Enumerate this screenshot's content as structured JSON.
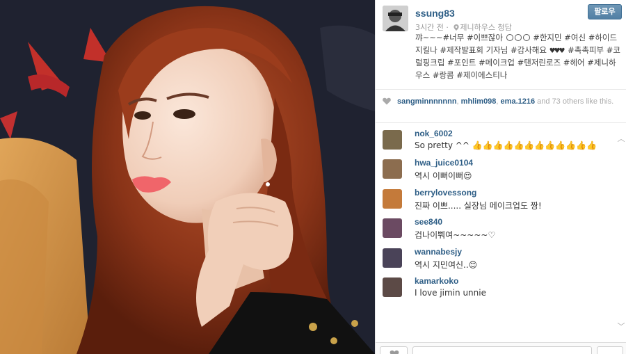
{
  "post": {
    "image_alt": "",
    "owner": {
      "username": "ssung83",
      "time_ago": "3시간 전",
      "separator": "·",
      "location": "제니하우스 청담"
    },
    "follow_label": "팔로우",
    "caption": {
      "part1": "꺄~~~#너무 #이쁘잖아 ",
      "part2": " #한지민 #여신 #하이드지킬나 #제작발표회 기자님 #감사해요 ",
      "part3": " #촉촉피부 #코럴핑크립 #포인트 #메이크업 #탠저린로즈 #헤어 #제니하우스 #랑콤 #제이에스티나"
    },
    "likes": {
      "users": [
        "sangminnnnnnn",
        "mhlim098",
        "ema.1216"
      ],
      "sep": ", ",
      "and": " and ",
      "others": "73 others like this."
    },
    "comments": [
      {
        "user": "nok_6002",
        "text": "So pretty ^^ 👍👍👍👍👍👍👍👍👍👍👍👍",
        "avatar_color": "#7a6a4c"
      },
      {
        "user": "hwa_juice0104",
        "text": "역시 이뻐이뻐😍",
        "avatar_color": "#8c6d4f"
      },
      {
        "user": "berrylovessong",
        "text": "진짜 이쁘..... 실장님 메이크업도 짱!",
        "avatar_color": "#c47a3a"
      },
      {
        "user": "see840",
        "text": "겁나이뿨여~~~~~♡",
        "avatar_color": "#6b4a62"
      },
      {
        "user": "wannabesjy",
        "text": "역시 지민여신..😊",
        "avatar_color": "#4a4358"
      },
      {
        "user": "kamarkoko",
        "text": "I love jimin unnie",
        "avatar_color": "#5c4a46"
      }
    ],
    "comment_placeholder": "",
    "colors": {
      "link": "#2e5e86",
      "follow_button": "#517fa4",
      "muted": "#999999"
    }
  }
}
